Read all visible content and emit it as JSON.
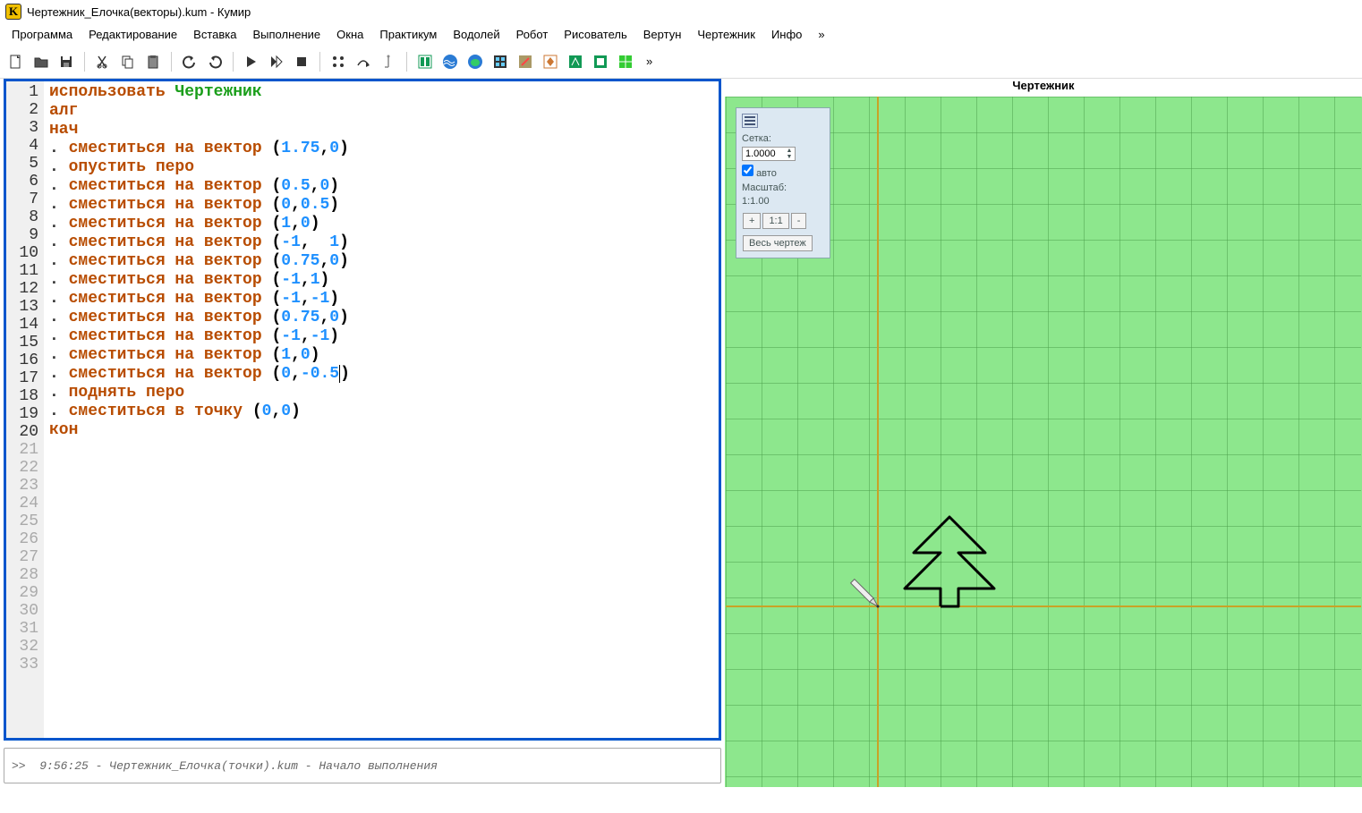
{
  "window": {
    "title": "Чертежник_Елочка(векторы).kum - Кумир",
    "app_letter": "K"
  },
  "menu": {
    "items": [
      "Программа",
      "Редактирование",
      "Вставка",
      "Выполнение",
      "Окна",
      "Практикум",
      "Водолей",
      "Робот",
      "Рисователь",
      "Вертун",
      "Чертежник",
      "Инфо",
      "»"
    ]
  },
  "toolbar": {
    "overflow": "»"
  },
  "editor": {
    "line_count": 33,
    "faded_from": 21,
    "code": [
      {
        "type": "use",
        "kw": "использовать",
        "mod": "Чертежник"
      },
      {
        "type": "kw",
        "text": "алг"
      },
      {
        "type": "kw",
        "text": "нач"
      },
      {
        "type": "cmd",
        "dot": ". ",
        "kw": "сместиться на вектор",
        "args": [
          [
            "1.75",
            "0"
          ]
        ]
      },
      {
        "type": "cmd",
        "dot": ". ",
        "kw": "опустить перо"
      },
      {
        "type": "cmd",
        "dot": ". ",
        "kw": "сместиться на вектор",
        "args": [
          [
            "0.5",
            "0"
          ]
        ]
      },
      {
        "type": "cmd",
        "dot": ". ",
        "kw": "сместиться на вектор",
        "args": [
          [
            "0",
            "0.5"
          ]
        ]
      },
      {
        "type": "cmd",
        "dot": ". ",
        "kw": "сместиться на вектор",
        "args": [
          [
            "1",
            "0"
          ]
        ]
      },
      {
        "type": "cmd",
        "dot": ". ",
        "kw": "сместиться на вектор",
        "args": [
          [
            "-1",
            " 1"
          ]
        ],
        "space_after_comma": true
      },
      {
        "type": "cmd",
        "dot": ". ",
        "kw": "сместиться на вектор",
        "args": [
          [
            "0.75",
            "0"
          ]
        ]
      },
      {
        "type": "cmd",
        "dot": ". ",
        "kw": "сместиться на вектор",
        "args": [
          [
            "-1",
            "1"
          ]
        ]
      },
      {
        "type": "cmd",
        "dot": ". ",
        "kw": "сместиться на вектор",
        "args": [
          [
            "-1",
            "-1"
          ]
        ]
      },
      {
        "type": "cmd",
        "dot": ". ",
        "kw": "сместиться на вектор",
        "args": [
          [
            "0.75",
            "0"
          ]
        ]
      },
      {
        "type": "cmd",
        "dot": ". ",
        "kw": "сместиться на вектор",
        "args": [
          [
            "-1",
            "-1"
          ]
        ]
      },
      {
        "type": "cmd",
        "dot": ". ",
        "kw": "сместиться на вектор",
        "args": [
          [
            "1",
            "0"
          ]
        ]
      },
      {
        "type": "cmd",
        "dot": ". ",
        "kw": "сместиться на вектор",
        "args": [
          [
            "0",
            "-0.5"
          ]
        ],
        "cursor": true
      },
      {
        "type": "cmd",
        "dot": ". ",
        "kw": "поднять перо"
      },
      {
        "type": "cmd",
        "dot": ". ",
        "kw": "сместиться в точку",
        "args": [
          [
            "0",
            "0"
          ]
        ]
      },
      {
        "type": "kw",
        "text": "кон"
      }
    ]
  },
  "console": {
    "prompt": ">>",
    "time": "9:56:25",
    "sep1": "-",
    "file": "Чертежник_Елочка(точки).kum",
    "sep2": "-",
    "msg": "Начало выполнения"
  },
  "drawer": {
    "title": "Чертежник",
    "panel": {
      "grid_label": "Сетка:",
      "grid_value": "1.0000",
      "auto_label": "авто",
      "auto_checked": true,
      "scale_label": "Масштаб:",
      "scale_value": "1:1.00",
      "plus": "+",
      "oneone": "1:1",
      "minus": "-",
      "fit": "Весь чертеж"
    }
  }
}
